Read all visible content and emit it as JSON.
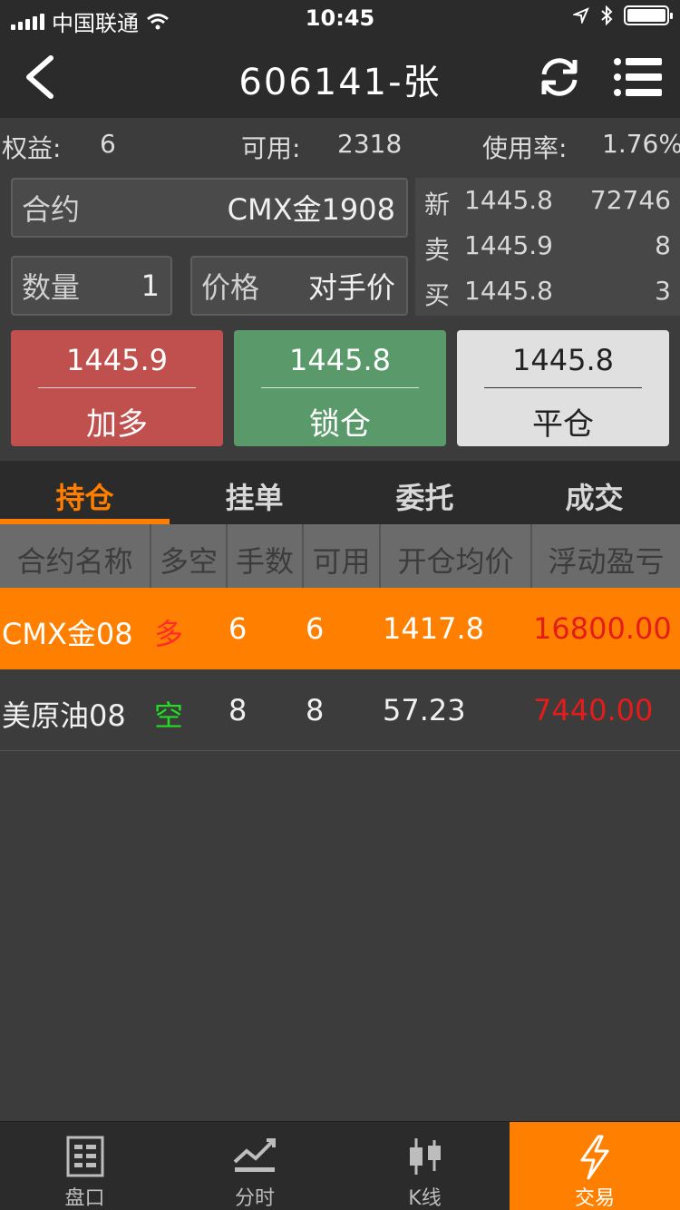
{
  "status_bar": {
    "carrier": "中国联通",
    "time": "10:45"
  },
  "header": {
    "title": "606141-张",
    "back_icon": "chevron-left-icon",
    "refresh_icon": "refresh-icon",
    "menu_icon": "menu-icon"
  },
  "account": {
    "equity_label": "权益:",
    "equity_value": "6",
    "available_label": "可用:",
    "available_value": "2318",
    "usage_label": "使用率:",
    "usage_value": "1.76%"
  },
  "order_form": {
    "contract_label": "合约",
    "contract_value": "CMX金1908",
    "quantity_label": "数量",
    "quantity_value": "1",
    "price_label": "价格",
    "price_value": "对手价"
  },
  "quote": {
    "rows": [
      {
        "label": "新",
        "price": "1445.8",
        "volume": "72746"
      },
      {
        "label": "卖",
        "price": "1445.9",
        "volume": "8"
      },
      {
        "label": "买",
        "price": "1445.8",
        "volume": "3"
      }
    ]
  },
  "actions": {
    "buy_long": {
      "price": "1445.9",
      "label": "加多"
    },
    "lock": {
      "price": "1445.8",
      "label": "锁仓"
    },
    "close": {
      "price": "1445.8",
      "label": "平仓"
    }
  },
  "tabs": [
    {
      "label": "持仓",
      "active": true
    },
    {
      "label": "挂单",
      "active": false
    },
    {
      "label": "委托",
      "active": false
    },
    {
      "label": "成交",
      "active": false
    }
  ],
  "positions": {
    "headers": [
      "合约名称",
      "多空",
      "手数",
      "可用",
      "开仓均价",
      "浮动盈亏"
    ],
    "rows": [
      {
        "name": "CMX金08",
        "direction": "多",
        "lots": "6",
        "available": "6",
        "avg_price": "1417.8",
        "pnl": "16800.00"
      },
      {
        "name": "美原油08",
        "direction": "空",
        "lots": "8",
        "available": "8",
        "avg_price": "57.23",
        "pnl": "7440.00"
      }
    ]
  },
  "bottom_nav": [
    {
      "label": "盘口",
      "icon": "orderbook-icon",
      "active": false
    },
    {
      "label": "分时",
      "icon": "line-chart-icon",
      "active": false
    },
    {
      "label": "K线",
      "icon": "candlestick-icon",
      "active": false
    },
    {
      "label": "交易",
      "icon": "lightning-icon",
      "active": true
    }
  ],
  "colors": {
    "accent": "#ff8000",
    "buy_red": "#c0504d",
    "lock_green": "#5a9a6a",
    "long_text": "#ff2a2a",
    "short_text": "#22dd22",
    "pnl_text": "#e41c1c"
  }
}
